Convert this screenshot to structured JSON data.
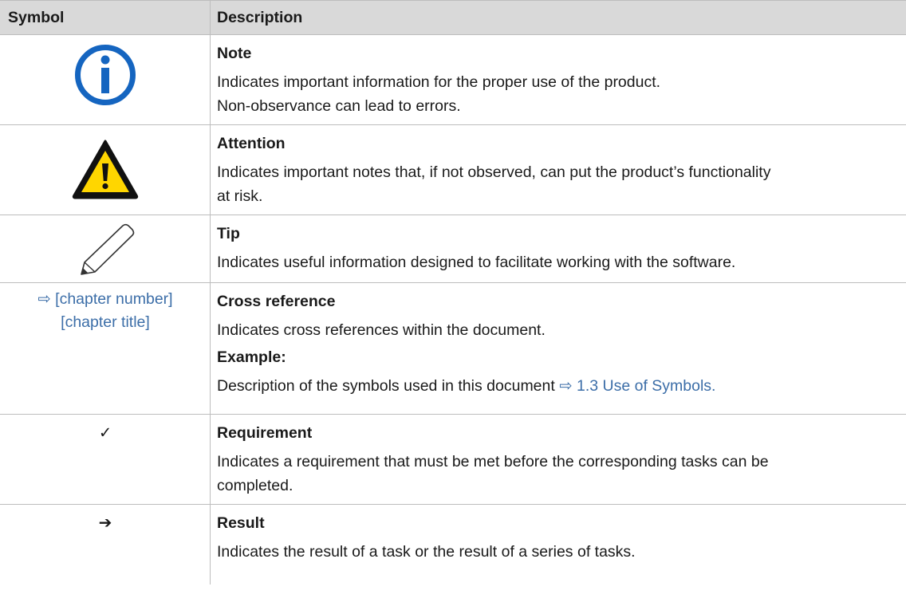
{
  "header": {
    "symbol": "Symbol",
    "description": "Description"
  },
  "rows": [
    {
      "icon": "info-icon",
      "title": "Note",
      "lines": [
        "Indicates important information for the proper use of the product.",
        "Non-observance can lead to errors."
      ]
    },
    {
      "icon": "warning-icon",
      "title": "Attention",
      "lines": [
        "Indicates important notes that, if not observed, can put the product’s functionality",
        "at risk."
      ]
    },
    {
      "icon": "pencil-icon",
      "title": "Tip",
      "lines": [
        "Indicates useful information designed to facilitate working with the software."
      ]
    },
    {
      "symbol_line1": "⇨ [chapter number]",
      "symbol_line2": "[chapter title]",
      "title": "Cross reference",
      "lines": [
        "Indicates cross references within the document."
      ],
      "example_label": "Example:",
      "example_text": "Description of the symbols used in this document ",
      "example_link": "⇨ 1.3 Use of Symbols."
    },
    {
      "symbol": "✓",
      "title": "Requirement",
      "lines": [
        "Indicates a requirement that must be met before the corresponding tasks can be",
        "completed."
      ]
    },
    {
      "symbol": "➔",
      "title": "Result",
      "lines": [
        "Indicates the result of a task or the result of a series of tasks."
      ]
    }
  ],
  "colors": {
    "header_bg": "#d9d9d9",
    "grid": "#bdbdbd",
    "info_blue": "#1565c0",
    "warning_yellow": "#ffd600",
    "link": "#3c6ea8"
  }
}
